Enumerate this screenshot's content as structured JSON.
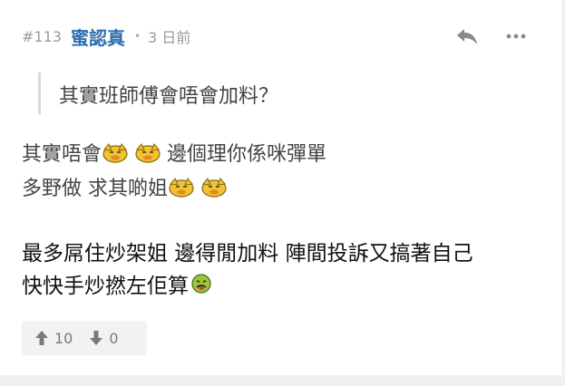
{
  "post": {
    "floor": "#113",
    "username": "蜜認真",
    "separator": "•",
    "time": "3 日前"
  },
  "icons": {
    "reply": "reply-icon",
    "more": "more-dots-icon",
    "upvote": "arrow-up-icon",
    "downvote": "arrow-down-icon",
    "emoji_dog": "dog-emoji-icon",
    "emoji_sick": "sick-face-emoji-icon"
  },
  "quote": {
    "nested_text": "其實班師傅會唔會加料？",
    "line1_text": "其實唔會",
    "line1_after": "邊個理你係咪彈單",
    "line2_text": "多野做 求其啲姐"
  },
  "body": {
    "line1": "最多屌住炒架姐 邊得閒加料 陣間投訴又搞著自己",
    "line2": "快快手炒撚左佢算"
  },
  "votes": {
    "up_count": "10",
    "down_count": "0"
  },
  "colors": {
    "username": "#2f6fb0",
    "meta": "#9a9a9a",
    "quote_border": "#d9d9d9",
    "vote_bg": "#f2f2f2",
    "icon_gray": "#8a8a8a"
  }
}
